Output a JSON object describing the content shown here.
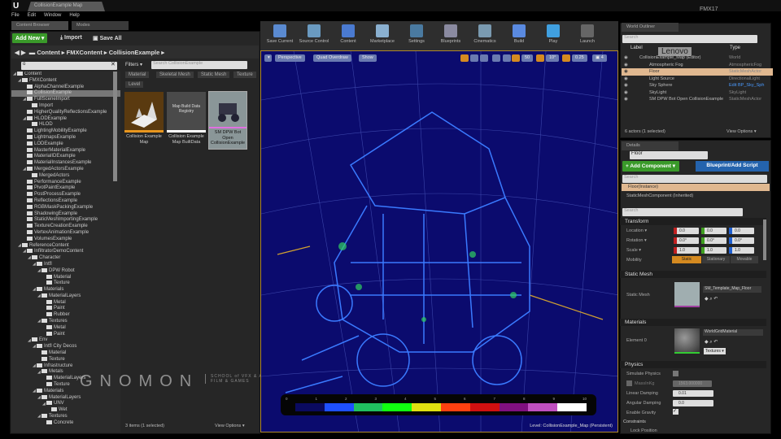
{
  "app": {
    "window_title": "CollisionExample Map",
    "corner_label": "FMX17",
    "menu": [
      "File",
      "Edit",
      "Window",
      "Help"
    ],
    "tabs": [
      "Content Browser",
      "Modes"
    ]
  },
  "content_browser": {
    "add_new": "Add New ▾",
    "import": "Import",
    "save_all": "Save All",
    "breadcrumb": [
      "Content",
      "FMXContent",
      "CollisionExample"
    ],
    "tree_search_value": "o",
    "filters_label": "Filters ▾",
    "asset_search_placeholder": "Search CollisionExample",
    "filter_chips": [
      "Material",
      "Skeletal Mesh",
      "Static Mesh",
      "Texture",
      "Level"
    ],
    "tree": [
      {
        "label": "Content",
        "level": 0,
        "open": true
      },
      {
        "label": "FMXContent",
        "level": 1,
        "open": true
      },
      {
        "label": "AlphaChannelExample",
        "level": 2
      },
      {
        "label": "CollisionExample",
        "level": 2,
        "selected": true
      },
      {
        "label": "FullSceneImport",
        "level": 2,
        "open": true
      },
      {
        "label": "Import",
        "level": 3
      },
      {
        "label": "HigherQualityReflectionsExample",
        "level": 2
      },
      {
        "label": "HLODExample",
        "level": 2,
        "open": true
      },
      {
        "label": "HLOD",
        "level": 3
      },
      {
        "label": "LightingMobilityExample",
        "level": 2
      },
      {
        "label": "LightmapsExample",
        "level": 2
      },
      {
        "label": "LODExample",
        "level": 2
      },
      {
        "label": "MasterMaterialExample",
        "level": 2
      },
      {
        "label": "MaterialIDExample",
        "level": 2
      },
      {
        "label": "MaterialInstancesExample",
        "level": 2
      },
      {
        "label": "MergedActorsExample",
        "level": 2,
        "open": true
      },
      {
        "label": "MergedActors",
        "level": 3
      },
      {
        "label": "PerformanceExample",
        "level": 2
      },
      {
        "label": "PivotPaintExample",
        "level": 2
      },
      {
        "label": "PostProcessExample",
        "level": 2
      },
      {
        "label": "ReflectionsExample",
        "level": 2
      },
      {
        "label": "RGBMaskPackingExample",
        "level": 2
      },
      {
        "label": "ShadowingExample",
        "level": 2
      },
      {
        "label": "StaticMeshImportingExample",
        "level": 2
      },
      {
        "label": "TextureCreationExample",
        "level": 2
      },
      {
        "label": "VertexAnimationExample",
        "level": 2
      },
      {
        "label": "VolumesExample",
        "level": 2
      },
      {
        "label": "ReferenceContent",
        "level": 1,
        "open": true
      },
      {
        "label": "InfiltratorDemoContent",
        "level": 2,
        "open": true
      },
      {
        "label": "Character",
        "level": 3,
        "open": true
      },
      {
        "label": "Intfl",
        "level": 4,
        "open": true
      },
      {
        "label": "DPW Robot",
        "level": 5,
        "open": true
      },
      {
        "label": "Material",
        "level": 6
      },
      {
        "label": "Texture",
        "level": 6
      },
      {
        "label": "Materials",
        "level": 4,
        "open": true
      },
      {
        "label": "MaterialLayers",
        "level": 5,
        "open": true
      },
      {
        "label": "Metal",
        "level": 6
      },
      {
        "label": "Paint",
        "level": 6
      },
      {
        "label": "Rubber",
        "level": 6
      },
      {
        "label": "Textures",
        "level": 5,
        "open": true
      },
      {
        "label": "Metal",
        "level": 6
      },
      {
        "label": "Paint",
        "level": 6
      },
      {
        "label": "Env",
        "level": 3,
        "open": true
      },
      {
        "label": "Intfl City Decos",
        "level": 4,
        "open": true
      },
      {
        "label": "Material",
        "level": 5
      },
      {
        "label": "Texture",
        "level": 5
      },
      {
        "label": "Infrastructure",
        "level": 4,
        "open": true
      },
      {
        "label": "Metals",
        "level": 5,
        "open": true
      },
      {
        "label": "MaterialLayers",
        "level": 6
      },
      {
        "label": "Texture",
        "level": 6
      },
      {
        "label": "Materials",
        "level": 4,
        "open": true
      },
      {
        "label": "MaterialLayers",
        "level": 5,
        "open": true
      },
      {
        "label": "UNV",
        "level": 6,
        "open": true
      },
      {
        "label": "Wet",
        "level": 7
      },
      {
        "label": "Textures",
        "level": 5,
        "open": true
      },
      {
        "label": "Concrete",
        "level": 6
      }
    ],
    "assets": [
      {
        "label": "Collision Example Map",
        "thumb": "Map",
        "color": "#e8961e"
      },
      {
        "label": "Collision Example Map BuiltData",
        "thumb": "Map Build Data Registry",
        "color": "#ffffff"
      },
      {
        "label": "SM DPW Bot Open CollisionExample",
        "thumb": "",
        "color": "#e070e0"
      }
    ],
    "status": "3 items (1 selected)",
    "view_options": "View Options ▾"
  },
  "toolbar": [
    "Save Current",
    "Source Control",
    "Content",
    "Marketplace",
    "Settings",
    "Blueprints",
    "Cinematics",
    "Build",
    "Play",
    "Launch"
  ],
  "viewport": {
    "perspective": "Perspective",
    "view_mode": "Quad Overdraw",
    "show": "Show",
    "grid_snap": "50",
    "rot_snap": "10°",
    "scale_snap": "0.25",
    "level_label": "Level:  CollisionExample_Map (Persistent)",
    "legend_ticks": [
      "0",
      "1",
      "2",
      "3",
      "4",
      "5",
      "6",
      "7",
      "8",
      "9",
      "10"
    ],
    "legend_colors": [
      "#0a0a60",
      "#1e50ff",
      "#20c060",
      "#10ff10",
      "#e0e010",
      "#ff4010",
      "#d01010",
      "#801080",
      "#c050c0",
      "#ffffff"
    ]
  },
  "watermark": {
    "brand": "GNOMON",
    "tagline": "SCHOOL of VFX & ANIMATION for FILM & GAMES",
    "overlay": "Lenovo"
  },
  "world_outliner": {
    "tab": "World Outliner",
    "search_placeholder": "Search",
    "col_label": "Label",
    "col_type": "Type",
    "rows": [
      {
        "label": "CollisionExample_Map (Editor)",
        "type": "World"
      },
      {
        "label": "Atmospheric Fog",
        "type": "AtmosphericFog"
      },
      {
        "label": "Floor",
        "type": "StaticMeshActor",
        "selected": true
      },
      {
        "label": "Light Source",
        "type": "DirectionalLight"
      },
      {
        "label": "Sky Sphere",
        "type": "Edit BP_Sky_Sph",
        "link": true
      },
      {
        "label": "SkyLight",
        "type": "SkyLight"
      },
      {
        "label": "SM DPW Bot Open CollisionExample",
        "type": "StaticMeshActor"
      }
    ],
    "status": "6 actors (1 selected)",
    "view_options": "View Options ▾"
  },
  "details": {
    "tab": "Details",
    "name": "Floor",
    "add_component": "+ Add Component ▾",
    "blueprint": "Blueprint/Add Script",
    "search_placeholder": "Search",
    "component_selected": "Floor(Instance)",
    "component_child": "StaticMeshComponent (Inherited)",
    "transform": {
      "title": "Transform",
      "location_label": "Location ▾",
      "rotation_label": "Rotation ▾",
      "scale_label": "Scale ▾",
      "mobility_label": "Mobility",
      "location": [
        "0.0",
        "0.0",
        "0.0"
      ],
      "rotation": [
        "0.0°",
        "0.0°",
        "0.0°"
      ],
      "scale": [
        "1.0",
        "1.0",
        "1.0"
      ],
      "mobility": [
        "Static",
        "Stationary",
        "Movable"
      ]
    },
    "static_mesh": {
      "title": "Static Mesh",
      "label": "Static Mesh",
      "value": "SM_Template_Map_Floor"
    },
    "materials": {
      "title": "Materials",
      "label": "Element 0",
      "value": "WorldGridMaterial",
      "textures": "Textures ▾"
    },
    "physics": {
      "title": "Physics",
      "simulate": "Simulate Physics",
      "mass_label": "MassInKg",
      "mass": "1563.000000",
      "linear_label": "Linear Damping",
      "linear": "0.01",
      "angular_label": "Angular Damping",
      "angular": "0.0",
      "gravity": "Enable Gravity",
      "constraints": "Constraints",
      "lock": "Lock Position"
    }
  }
}
